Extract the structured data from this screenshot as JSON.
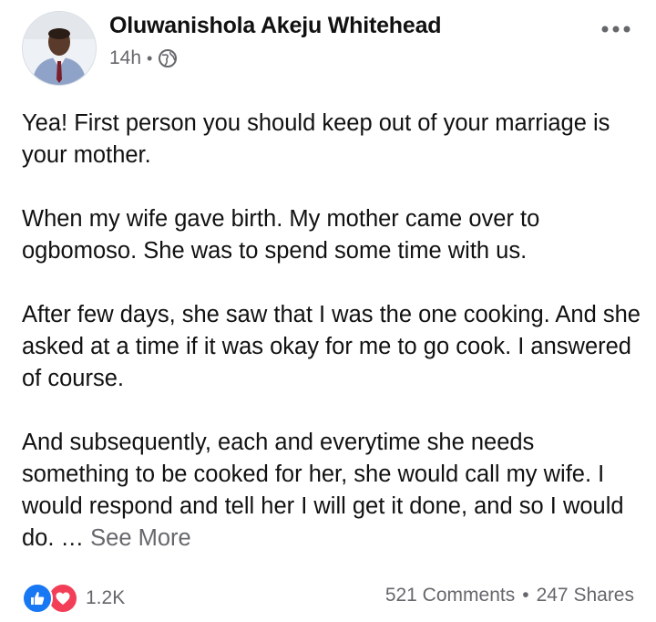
{
  "post": {
    "author": "Oluwanishola Akeju Whitehead",
    "time": "14h",
    "separator": "•",
    "audience_icon": "globe-icon",
    "paragraphs": [
      "Yea! First person you should keep out of your marriage is your mother.",
      "When my wife gave birth. My mother came over to ogbomoso. She was to spend some time with us.",
      "After few days, she saw that I was the one cooking. And she asked at a time if it was okay for me to go cook. I answered of course."
    ],
    "last_paragraph": "And subsequently, each and everytime she needs something to be cooked for her, she would call my wife. I would respond and tell her I will get it done, and so I would do.",
    "ellipsis": " … ",
    "see_more": "See More"
  },
  "footer": {
    "reaction_icons": [
      "like-icon",
      "love-icon"
    ],
    "reaction_count": "1.2K",
    "comments": "521 Comments",
    "separator": "•",
    "shares": "247 Shares"
  },
  "colors": {
    "like": "#1877f2",
    "love": "#f33e58",
    "secondary_text": "#65676b"
  }
}
